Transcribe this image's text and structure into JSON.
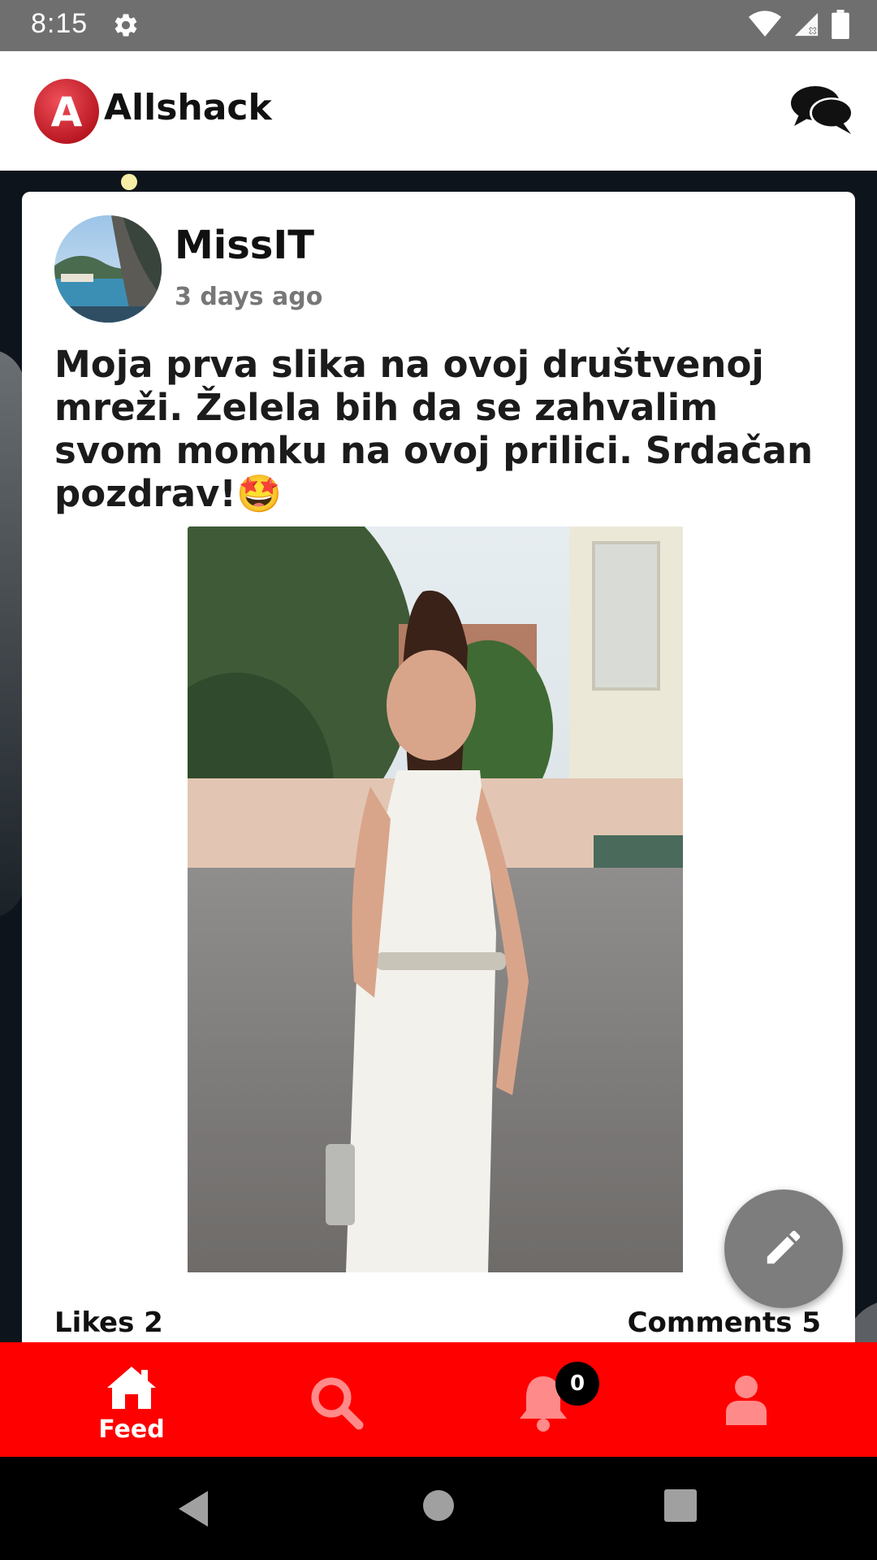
{
  "status_bar": {
    "time": "8:15",
    "icons": [
      "gear-icon",
      "wifi-icon",
      "signal-icon",
      "battery-icon"
    ]
  },
  "header": {
    "logo_letter": "A",
    "app_title": "Allshack",
    "chat_icon": "chat-bubbles-icon"
  },
  "post": {
    "author": "MissIT",
    "time_ago": "3 days ago",
    "text": "Moja prva slika na ovoj društvenoj mreži. Želela bih da se zahvalim svom momku na ovoj prilici. Srdačan pozdrav!🤩",
    "likes_label": "Likes 2",
    "comments_label": "Comments 5"
  },
  "fab": {
    "icon": "pencil-icon"
  },
  "bottom_nav": {
    "feed_label": "Feed",
    "notifications_badge": "0",
    "items": [
      "home-icon",
      "search-icon",
      "bell-icon",
      "user-icon"
    ]
  },
  "colors": {
    "accent": "#ff0000",
    "header_bg": "#ffffff",
    "feed_bg": "#0e141b",
    "fab": "#7d7d7d",
    "status_bar": "#6f6f6f"
  }
}
